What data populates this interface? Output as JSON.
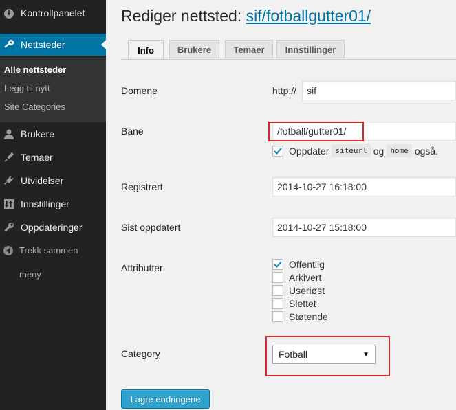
{
  "sidebar": {
    "items": [
      {
        "label": "Kontrollpanelet",
        "icon": "dashboard-icon"
      },
      {
        "label": "Nettsteder",
        "icon": "key-icon"
      },
      {
        "label": "Brukere",
        "icon": "users-icon"
      },
      {
        "label": "Temaer",
        "icon": "brush-icon"
      },
      {
        "label": "Utvidelser",
        "icon": "plugin-icon"
      },
      {
        "label": "Innstillinger",
        "icon": "settings-icon"
      },
      {
        "label": "Oppdateringer",
        "icon": "wrench-icon"
      }
    ],
    "submenu": [
      "Alle nettsteder",
      "Legg til nytt",
      "Site Categories"
    ],
    "collapse": {
      "line1": "Trekk sammen",
      "line2": "meny"
    }
  },
  "page": {
    "title_prefix": "Rediger nettsted: ",
    "title_link": "sif/fotballgutter01/"
  },
  "tabs": [
    "Info",
    "Brukere",
    "Temaer",
    "Innstillinger"
  ],
  "form": {
    "domain": {
      "label": "Domene",
      "prefix": "http://",
      "value": "sif"
    },
    "path": {
      "label": "Bane",
      "value": "/fotball/gutter01/"
    },
    "update_row": {
      "before": "Oppdater",
      "code1": "siteurl",
      "mid": "og",
      "code2": "home",
      "after": "også.",
      "checked": true
    },
    "registered": {
      "label": "Registrert",
      "value": "2014-10-27 16:18:00"
    },
    "updated": {
      "label": "Sist oppdatert",
      "value": "2014-10-27 15:18:00"
    },
    "attributes": {
      "label": "Attributter",
      "options": [
        {
          "label": "Offentlig",
          "checked": true
        },
        {
          "label": "Arkivert",
          "checked": false
        },
        {
          "label": "Useriøst",
          "checked": false
        },
        {
          "label": "Slettet",
          "checked": false
        },
        {
          "label": "Støtende",
          "checked": false
        }
      ]
    },
    "category": {
      "label": "Category",
      "selected": "Fotball"
    }
  },
  "save_label": "Lagre endringene",
  "colors": {
    "accent": "#0074a2",
    "button": "#2ea2cc",
    "highlight": "#d9262c",
    "sidebar": "#222222"
  }
}
